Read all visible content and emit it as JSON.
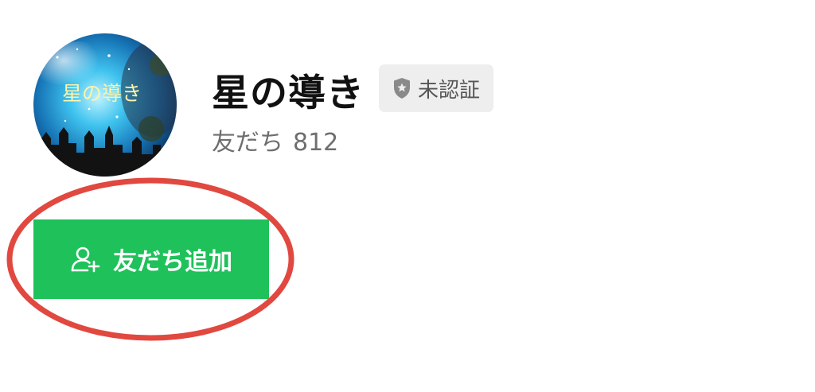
{
  "profile": {
    "avatar_text": "星の導き",
    "name": "星の導き",
    "badge_label": "未認証",
    "friends_label": "友だち",
    "friends_count": "812"
  },
  "actions": {
    "add_friend_label": "友だち追加"
  },
  "icons": {
    "badge": "shield-star-icon",
    "add_friend": "user-plus-icon"
  },
  "colors": {
    "accent_green": "#1fc15a",
    "badge_bg": "#eeeeee",
    "annotation_red": "#e1483f"
  }
}
